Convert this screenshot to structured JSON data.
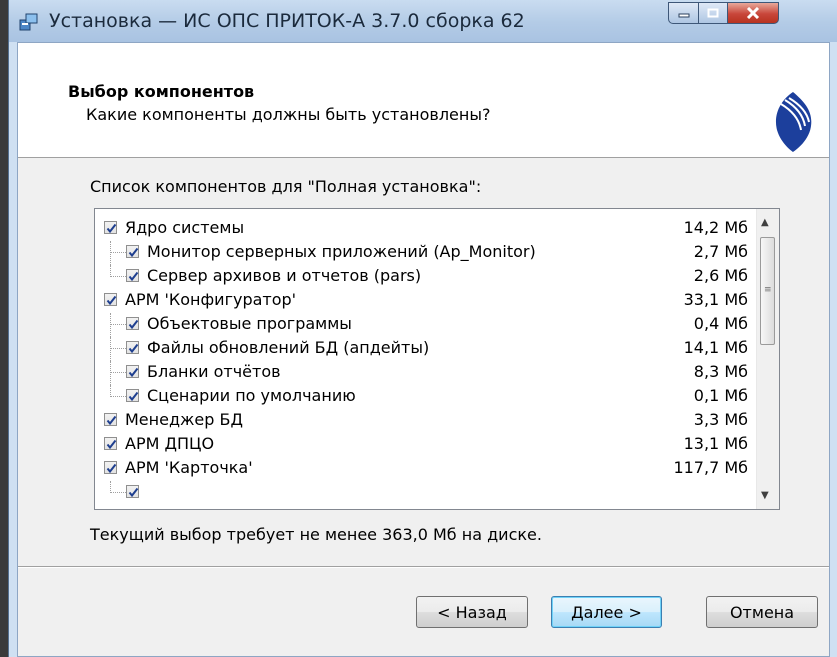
{
  "window": {
    "title": "Установка — ИС ОПС ПРИТОК-А 3.7.0 сборка 62",
    "controls": {
      "minimize_icon": "minimize-icon",
      "maximize_icon": "maximize-icon",
      "close_icon": "close-icon"
    }
  },
  "header": {
    "title": "Выбор компонентов",
    "subtitle": "Какие компоненты должны быть установлены?"
  },
  "components": {
    "caption": "Список компонентов для \"Полная установка\":",
    "items": [
      {
        "label": "Ядро системы",
        "size": "14,2 Мб",
        "level": 0,
        "checked": true
      },
      {
        "label": "Монитор серверных приложений (Ap_Monitor)",
        "size": "2,7 Мб",
        "level": 1,
        "checked": true
      },
      {
        "label": "Сервер архивов и отчетов (pars)",
        "size": "2,6 Мб",
        "level": 1,
        "checked": true
      },
      {
        "label": "АРМ 'Конфигуратор'",
        "size": "33,1 Мб",
        "level": 0,
        "checked": true
      },
      {
        "label": "Объектовые программы",
        "size": "0,4 Мб",
        "level": 1,
        "checked": true
      },
      {
        "label": "Файлы обновлений БД (апдейты)",
        "size": "14,1 Мб",
        "level": 1,
        "checked": true
      },
      {
        "label": "Бланки отчётов",
        "size": "8,3 Мб",
        "level": 1,
        "checked": true
      },
      {
        "label": "Сценарии по умолчанию",
        "size": "0,1 Мб",
        "level": 1,
        "checked": true
      },
      {
        "label": "Менеджер БД",
        "size": "3,3 Мб",
        "level": 0,
        "checked": true
      },
      {
        "label": "АРМ ДПЦО",
        "size": "13,1 Мб",
        "level": 0,
        "checked": true
      },
      {
        "label": "АРМ 'Карточка'",
        "size": "117,7 Мб",
        "level": 0,
        "checked": true
      },
      {
        "label": "",
        "size": "",
        "level": 1,
        "checked": true
      }
    ]
  },
  "disk_requirement": "Текущий выбор требует не менее 363,0 Мб на диске.",
  "buttons": {
    "back": "< Назад",
    "next": "Далее >",
    "cancel": "Отмена"
  },
  "colors": {
    "accent": "#3c7fb1",
    "close": "#c8463a",
    "check": "#1f3f8f"
  }
}
